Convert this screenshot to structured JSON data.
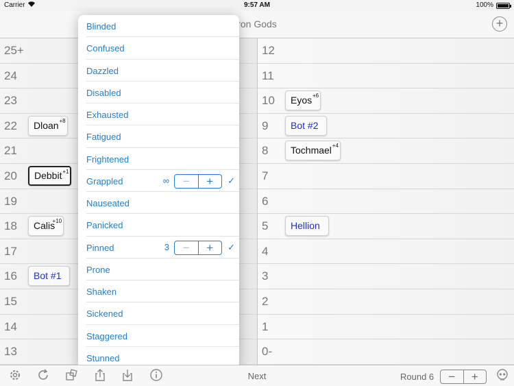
{
  "status_bar": {
    "carrier": "Carrier",
    "time": "9:57 AM",
    "battery": "100%"
  },
  "nav": {
    "title": "ron Gods",
    "add_icon": "plus-circle-icon"
  },
  "left_rows": [
    {
      "num": "25+"
    },
    {
      "num": "24"
    },
    {
      "num": "23"
    },
    {
      "num": "22",
      "token": "Dloan",
      "mod": "+8"
    },
    {
      "num": "21"
    },
    {
      "num": "20",
      "token": "Debbit",
      "mod": "+1"
    },
    {
      "num": "19"
    },
    {
      "num": "18",
      "token": "Calis",
      "mod": "+10"
    },
    {
      "num": "17"
    },
    {
      "num": "16",
      "token": "Bot #1"
    },
    {
      "num": "15"
    },
    {
      "num": "14"
    },
    {
      "num": "13"
    }
  ],
  "right_rows": [
    {
      "num": "12"
    },
    {
      "num": "11"
    },
    {
      "num": "10",
      "token": "Eyos",
      "mod": "+6"
    },
    {
      "num": "9",
      "token": "Bot #2"
    },
    {
      "num": "8",
      "token": "Tochmael",
      "mod": "+4"
    },
    {
      "num": "7"
    },
    {
      "num": "6"
    },
    {
      "num": "5",
      "token": "Hellion"
    },
    {
      "num": "4"
    },
    {
      "num": "3"
    },
    {
      "num": "2"
    },
    {
      "num": "1"
    },
    {
      "num": "0-"
    }
  ],
  "conditions": [
    {
      "label": "Blinded"
    },
    {
      "label": "Confused"
    },
    {
      "label": "Dazzled"
    },
    {
      "label": "Disabled"
    },
    {
      "label": "Exhausted"
    },
    {
      "label": "Fatigued"
    },
    {
      "label": "Frightened"
    },
    {
      "label": "Grappled",
      "count": "∞",
      "minus": "−",
      "plus": "+",
      "check": "✓"
    },
    {
      "label": "Nauseated"
    },
    {
      "label": "Panicked"
    },
    {
      "label": "Pinned",
      "count": "3",
      "minus": "−",
      "plus": "+",
      "check": "✓"
    },
    {
      "label": "Prone"
    },
    {
      "label": "Shaken"
    },
    {
      "label": "Sickened"
    },
    {
      "label": "Staggered"
    },
    {
      "label": "Stunned"
    }
  ],
  "toolbar": {
    "next_label": "Next",
    "round_label": "Round 6",
    "minus": "−",
    "plus": "+",
    "icons": [
      "gear-icon",
      "refresh-icon",
      "dice-icon",
      "share-icon",
      "download-icon",
      "info-icon",
      "skull-icon"
    ]
  }
}
